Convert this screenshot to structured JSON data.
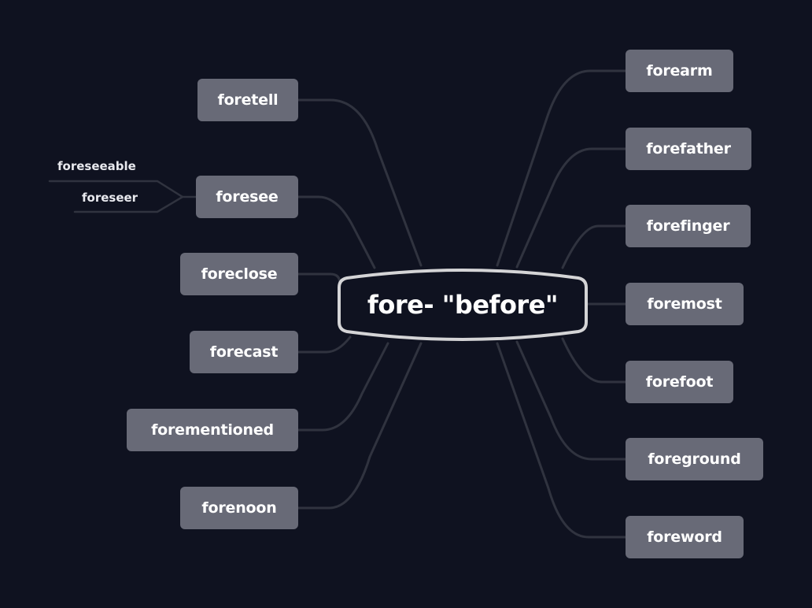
{
  "diagram": {
    "type": "mind-map",
    "colors": {
      "background": "#0f1220",
      "node_fill": "#686a77",
      "node_text": "#ffffff",
      "link": "#30333f",
      "center_border": "#d4d4d6"
    },
    "center": {
      "label": "fore- \"before\""
    },
    "left_branches": [
      {
        "label": "foretell",
        "children": []
      },
      {
        "label": "foresee",
        "children": [
          "foreseeable",
          "foreseer"
        ]
      },
      {
        "label": "foreclose",
        "children": []
      },
      {
        "label": "forecast",
        "children": []
      },
      {
        "label": "forementioned",
        "children": []
      },
      {
        "label": "forenoon",
        "children": []
      }
    ],
    "right_branches": [
      {
        "label": "forearm"
      },
      {
        "label": "forefather"
      },
      {
        "label": "forefinger"
      },
      {
        "label": "foremost"
      },
      {
        "label": "forefoot"
      },
      {
        "label": "foreground"
      },
      {
        "label": "foreword"
      }
    ]
  }
}
